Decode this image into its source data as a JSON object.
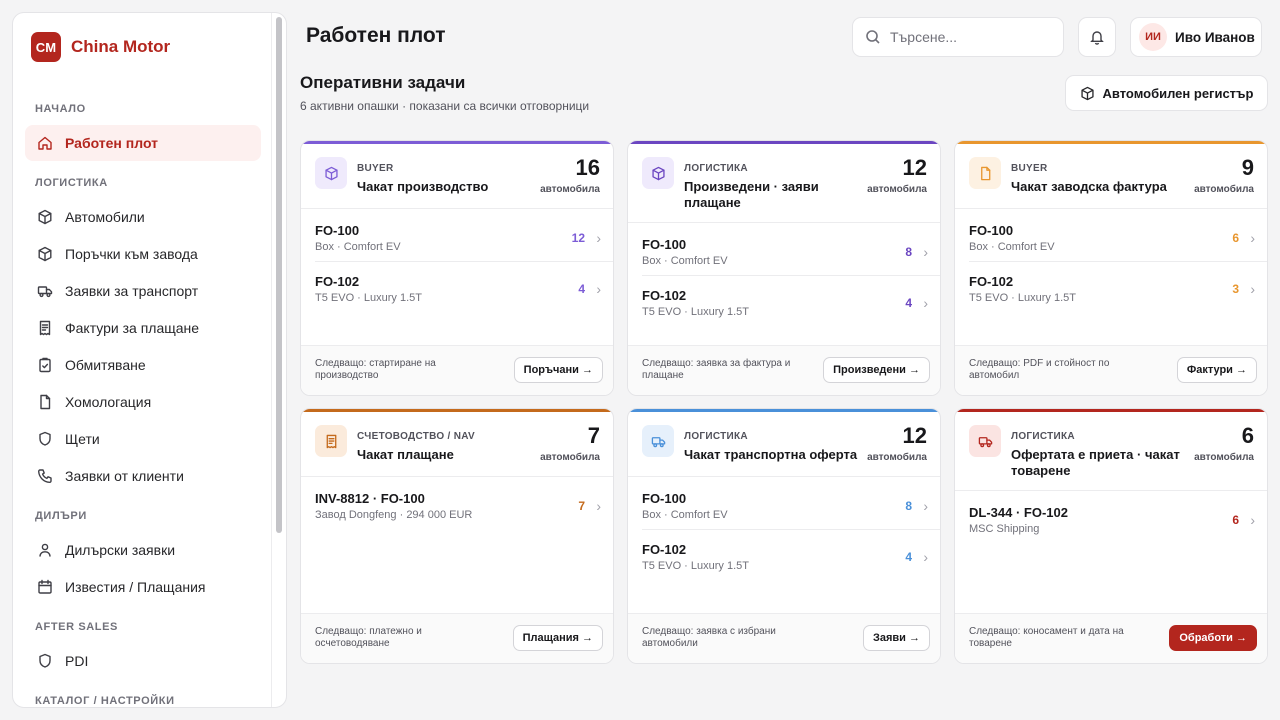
{
  "brand": {
    "logo": "CM",
    "name": "China Motor",
    "color": "#b3261e"
  },
  "sidebar": {
    "sections": [
      {
        "label": "НАЧАЛО",
        "items": [
          {
            "label": "Работен плот",
            "icon": "home-icon",
            "active": true
          }
        ]
      },
      {
        "label": "ЛОГИСТИКА",
        "items": [
          {
            "label": "Автомобили",
            "icon": "box-icon"
          },
          {
            "label": "Поръчки към завода",
            "icon": "box-icon"
          },
          {
            "label": "Заявки за транспорт",
            "icon": "truck-icon"
          },
          {
            "label": "Фактури за плащане",
            "icon": "receipt-icon"
          },
          {
            "label": "Обмитяване",
            "icon": "clipboard-check-icon"
          },
          {
            "label": "Хомологация",
            "icon": "file-icon"
          },
          {
            "label": "Щети",
            "icon": "shield-icon"
          },
          {
            "label": "Заявки от клиенти",
            "icon": "phone-icon"
          }
        ]
      },
      {
        "label": "ДИЛЪРИ",
        "items": [
          {
            "label": "Дилърски заявки",
            "icon": "user-icon"
          },
          {
            "label": "Известия / Плащания",
            "icon": "calendar-icon"
          }
        ]
      },
      {
        "label": "AFTER SALES",
        "items": [
          {
            "label": "PDI",
            "icon": "shield-icon"
          }
        ]
      },
      {
        "label": "КАТАЛОГ / НАСТРОЙКИ",
        "items": []
      }
    ]
  },
  "header": {
    "title": "Работен плот",
    "search_placeholder": "Търсене...",
    "user": {
      "initials": "ИИ",
      "name": "Иво Иванов"
    }
  },
  "section": {
    "title": "Оперативни задачи",
    "subtitle": "6 активни опашки · показани са всички отговорници",
    "register_button": "Автомобилен регистър"
  },
  "cards": [
    {
      "category": "BUYER",
      "title": "Чакат производство",
      "count": "16",
      "unit": "автомобила",
      "color": "#7c5cd6",
      "icon_bg": "#efeafc",
      "icon": "box-icon",
      "rows": [
        {
          "title": "FO-100",
          "sub": "Box · Comfort EV",
          "count": "12"
        },
        {
          "title": "FO-102",
          "sub": "T5 EVO · Luxury 1.5T",
          "count": "4"
        }
      ],
      "next": "Следващо: стартиране на производство",
      "action": "Поръчани →",
      "primary": false
    },
    {
      "category": "ЛОГИСТИКА",
      "title": "Произведени · заяви плащане",
      "count": "12",
      "unit": "автомобила",
      "color": "#6b46c1",
      "icon_bg": "#efeafc",
      "icon": "box-icon",
      "rows": [
        {
          "title": "FO-100",
          "sub": "Box · Comfort EV",
          "count": "8"
        },
        {
          "title": "FO-102",
          "sub": "T5 EVO · Luxury 1.5T",
          "count": "4"
        }
      ],
      "next": "Следващо: заявка за фактура и плащане",
      "action": "Произведени →",
      "primary": false
    },
    {
      "category": "BUYER",
      "title": "Чакат заводска фактура",
      "count": "9",
      "unit": "автомобила",
      "color": "#e8962e",
      "icon_bg": "#fdf1e2",
      "icon": "file-icon",
      "rows": [
        {
          "title": "FO-100",
          "sub": "Box · Comfort EV",
          "count": "6"
        },
        {
          "title": "FO-102",
          "sub": "T5 EVO · Luxury 1.5T",
          "count": "3"
        }
      ],
      "next": "Следващо: PDF и стойност по автомобил",
      "action": "Фактури →",
      "primary": false
    },
    {
      "category": "СЧЕТОВОДСТВО / NAV",
      "title": "Чакат плащане",
      "count": "7",
      "unit": "автомобила",
      "color": "#c46a1c",
      "icon_bg": "#fbebdc",
      "icon": "receipt-icon",
      "rows": [
        {
          "title": "INV-8812 · FO-100",
          "sub": "Завод Dongfeng · 294 000 EUR",
          "count": "7"
        }
      ],
      "next": "Следващо: платежно и осчетоводяване",
      "action": "Плащания →",
      "primary": false
    },
    {
      "category": "ЛОГИСТИКА",
      "title": "Чакат транспортна оферта",
      "count": "12",
      "unit": "автомобила",
      "color": "#4a90d9",
      "icon_bg": "#e6f0fb",
      "icon": "truck-icon",
      "rows": [
        {
          "title": "FO-100",
          "sub": "Box · Comfort EV",
          "count": "8"
        },
        {
          "title": "FO-102",
          "sub": "T5 EVO · Luxury 1.5T",
          "count": "4"
        }
      ],
      "next": "Следващо: заявка с избрани автомобили",
      "action": "Заяви →",
      "primary": false
    },
    {
      "category": "ЛОГИСТИКА",
      "title": "Офертата е приета · чакат товарене",
      "count": "6",
      "unit": "автомобила",
      "color": "#b3261e",
      "icon_bg": "#fbe4e2",
      "icon": "truck-icon",
      "rows": [
        {
          "title": "DL-344 · FO-102",
          "sub": "MSC Shipping",
          "count": "6"
        }
      ],
      "next": "Следващо: коносамент и дата на товарене",
      "action": "Обработи →",
      "primary": true
    }
  ]
}
